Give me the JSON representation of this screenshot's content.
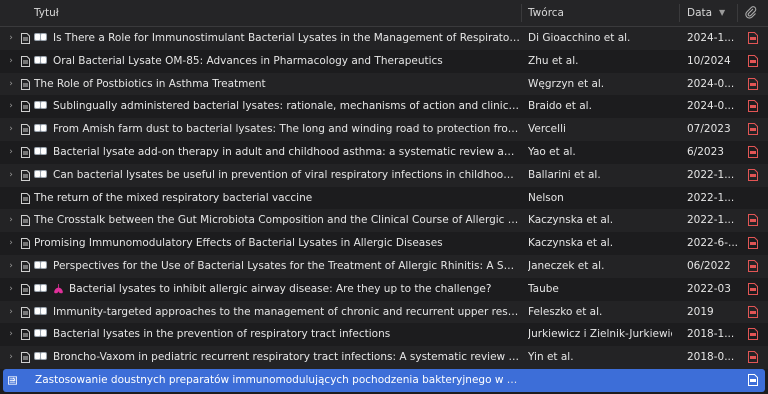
{
  "columns": {
    "title": "Tytuł",
    "creator": "Twórca",
    "date": "Data"
  },
  "rows": [
    {
      "title": "Is There a Role for Immunostimulant Bacterial Lysates in the Management of Respiratory Tract I...",
      "creator": "Di Gioacchino et al.",
      "date": "2024-1...",
      "expandable": true,
      "tags": true,
      "emoji": false,
      "pdf": true,
      "selected": false
    },
    {
      "title": "Oral Bacterial Lysate OM-85: Advances in Pharmacology and Therapeutics",
      "creator": "Zhu et al.",
      "date": "10/2024",
      "expandable": true,
      "tags": true,
      "emoji": false,
      "pdf": true,
      "selected": false
    },
    {
      "title": "The Role of Postbiotics in Asthma Treatment",
      "creator": "Węgrzyn et al.",
      "date": "2024-0...",
      "expandable": true,
      "tags": false,
      "emoji": false,
      "pdf": true,
      "selected": false
    },
    {
      "title": "Sublingually administered bacterial lysates: rationale, mechanisms of action and clinical outcomes",
      "creator": "Braido et al.",
      "date": "2024-0...",
      "expandable": true,
      "tags": true,
      "emoji": false,
      "pdf": true,
      "selected": false
    },
    {
      "title": "From Amish farm dust to bacterial lysates: The long and winding road to protection from allerg...",
      "creator": "Vercelli",
      "date": "07/2023",
      "expandable": true,
      "tags": true,
      "emoji": false,
      "pdf": true,
      "selected": false
    },
    {
      "title": "Bacterial lysate add-on therapy in adult and childhood asthma: a systematic review and meta-a...",
      "creator": "Yao et al.",
      "date": "6/2023",
      "expandable": true,
      "tags": true,
      "emoji": false,
      "pdf": true,
      "selected": false
    },
    {
      "title": "Can bacterial lysates be useful in prevention of viral respiratory infections in childhood? The res...",
      "creator": "Ballarini et al.",
      "date": "2022-1...",
      "expandable": true,
      "tags": true,
      "emoji": false,
      "pdf": true,
      "selected": false
    },
    {
      "title": "The return of the mixed respiratory bacterial vaccine",
      "creator": "Nelson",
      "date": "2022-1...",
      "expandable": false,
      "tags": false,
      "emoji": false,
      "pdf": false,
      "selected": false
    },
    {
      "title": "The Crosstalk between the Gut Microbiota Composition and the Clinical Course of Allergic Rhinitis: ...",
      "creator": "Kaczynska et al.",
      "date": "2022-1...",
      "expandable": true,
      "tags": false,
      "emoji": false,
      "pdf": true,
      "selected": false
    },
    {
      "title": "Promising Immunomodulatory Effects of Bacterial Lysates in Allergic Diseases",
      "creator": "Kaczynska et al.",
      "date": "2022-6-...",
      "expandable": true,
      "tags": false,
      "emoji": false,
      "pdf": true,
      "selected": false
    },
    {
      "title": "Perspectives for the Use of Bacterial Lysates for the Treatment of Allergic Rhinitis: A Systematic ...",
      "creator": "Janeczek et al.",
      "date": "06/2022",
      "expandable": true,
      "tags": true,
      "emoji": false,
      "pdf": true,
      "selected": false
    },
    {
      "title": "Bacterial lysates to inhibit allergic airway disease: Are they up to the challenge?",
      "creator": "Taube",
      "date": "2022-03",
      "expandable": true,
      "tags": true,
      "emoji": true,
      "pdf": true,
      "selected": false
    },
    {
      "title": "Immunity-targeted approaches to the management of chronic and recurrent upper respiratory t...",
      "creator": "Feleszko et al.",
      "date": "2019",
      "expandable": true,
      "tags": true,
      "emoji": false,
      "pdf": true,
      "selected": false
    },
    {
      "title": "Bacterial lysates in the prevention of respiratory tract infections",
      "creator": "Jurkiewicz i Zielnik-Jurkiewicz",
      "date": "2018-1...",
      "expandable": true,
      "tags": true,
      "emoji": false,
      "pdf": true,
      "selected": false
    },
    {
      "title": "Broncho-Vaxom in pediatric recurrent respiratory tract infections: A systematic review and meta...",
      "creator": "Yin et al.",
      "date": "2018-0...",
      "expandable": true,
      "tags": true,
      "emoji": false,
      "pdf": true,
      "selected": false
    },
    {
      "title": "Zastosowanie doustnych preparatów immunomodulujących pochodzenia bakteryjnego w profilaktyc...",
      "creator": "",
      "date": "",
      "expandable": true,
      "tags": false,
      "emoji": false,
      "pdf": true,
      "selected": true,
      "type": "newspaper"
    }
  ],
  "colors": {
    "background": "#1d1d1f",
    "selection": "#3d6ed8",
    "pdf_icon": "#e25555",
    "emoji": "#e0309a"
  }
}
